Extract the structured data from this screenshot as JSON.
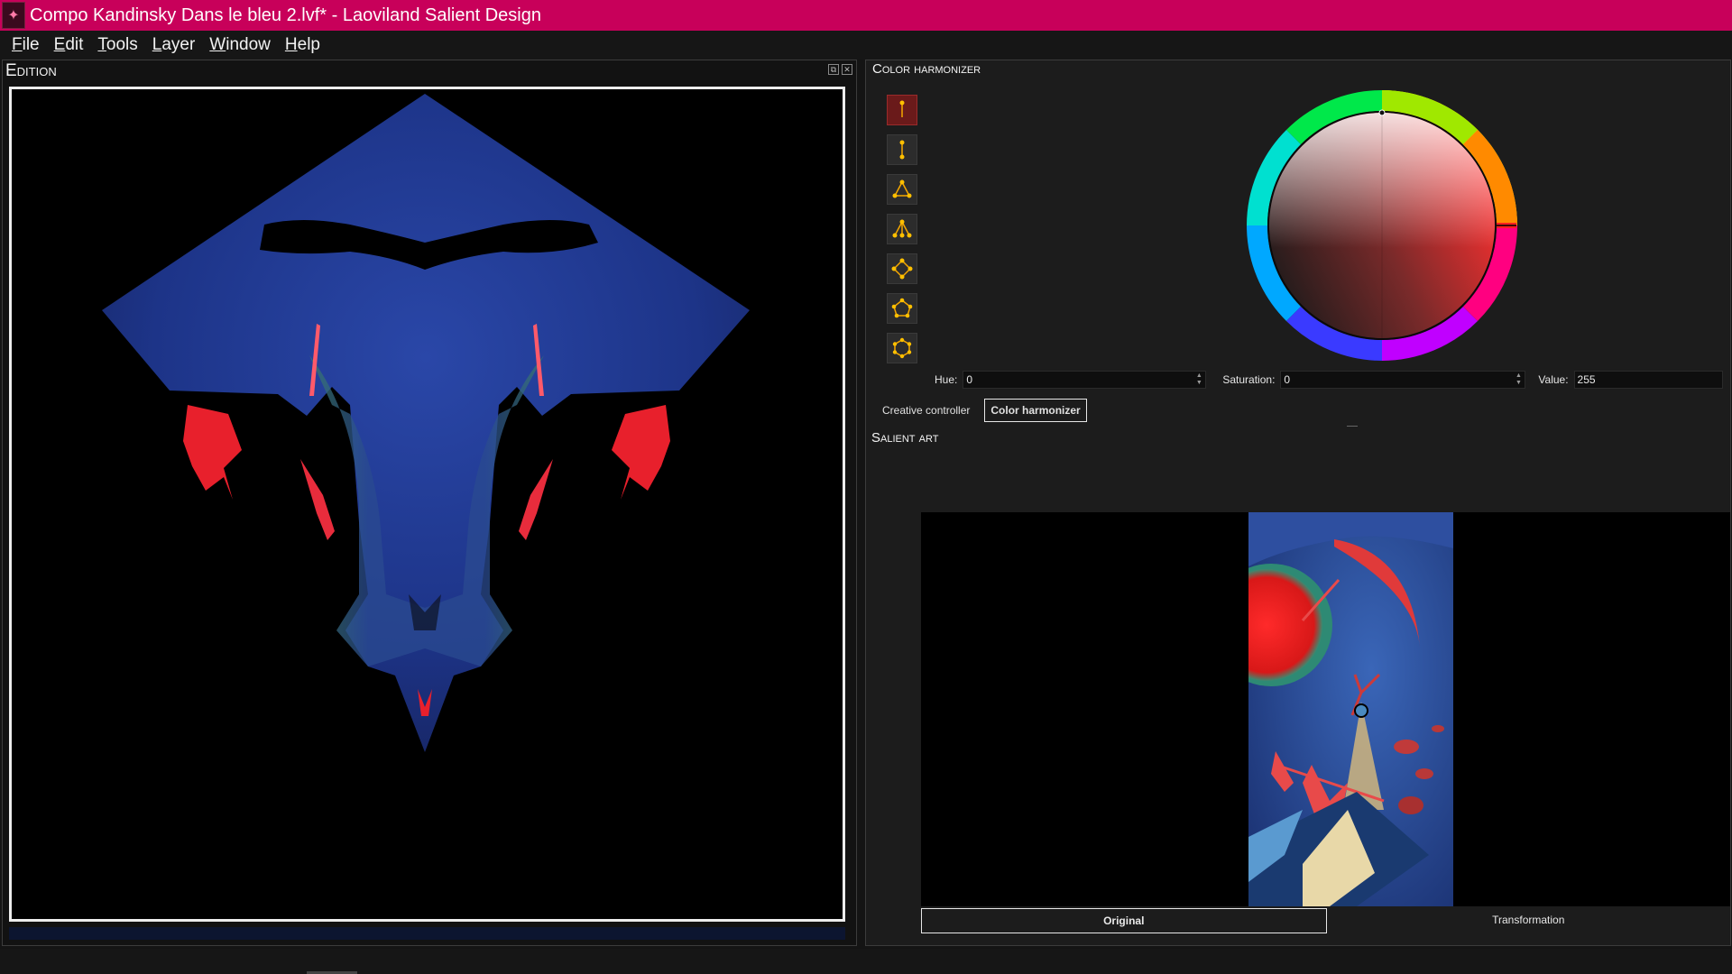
{
  "window": {
    "title": "Compo Kandinsky Dans le bleu 2.lvf* - Laoviland Salient Design",
    "app_icon": "app-logo-icon",
    "accent_color": "#c8005a"
  },
  "menu": {
    "items": [
      "File",
      "Edit",
      "Tools",
      "Layer",
      "Window",
      "Help"
    ]
  },
  "edition": {
    "title": "Edition",
    "float_icon": "undock-icon",
    "close_icon": "close-icon"
  },
  "harmonizer": {
    "title": "Color harmonizer",
    "tools": [
      {
        "name": "monochromatic-harmony-icon",
        "active": true
      },
      {
        "name": "complementary-harmony-icon",
        "active": false
      },
      {
        "name": "triad-harmony-icon",
        "active": false
      },
      {
        "name": "split-triad-harmony-icon",
        "active": false
      },
      {
        "name": "square-harmony-icon",
        "active": false
      },
      {
        "name": "pentagon-harmony-icon",
        "active": false
      },
      {
        "name": "hexagon-harmony-icon",
        "active": false
      }
    ],
    "hue_label": "Hue:",
    "hue_value": "0",
    "saturation_label": "Saturation:",
    "saturation_value": "0",
    "value_label": "Value:",
    "value_value": "255"
  },
  "controller_tabs": {
    "creative": "Creative controller",
    "harmonizer": "Color harmonizer",
    "selected": "Color harmonizer"
  },
  "salient": {
    "title": "Salient art",
    "tabs": {
      "original": "Original",
      "transformation": "Transformation",
      "selected": "Original"
    }
  }
}
